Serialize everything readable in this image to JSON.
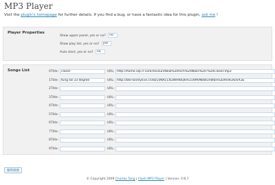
{
  "header": {
    "title": "MP3 Player",
    "intro_prefix": "Visit the ",
    "homepage_link": "plugin's homepage",
    "intro_middle": " for further details. If you find a bug, or have a fantastic idea for this plugin, ",
    "ask_link": "ask me",
    "intro_suffix": " !"
  },
  "player_properties": {
    "label": "Player Properties",
    "options": [
      {
        "label": "Show upper panel, yes or no?",
        "value": "no"
      },
      {
        "label": "Show play list, yes or no?",
        "value": "yes"
      },
      {
        "label": "Auto start, yes or no?",
        "value": "no"
      }
    ]
  },
  "songs_list": {
    "label": "Songs List",
    "title_label": "Title:",
    "url_label": "URL:",
    "songs": [
      {
        "num": "0",
        "title": "closer",
        "url": "http://home.xlp.rr.com/elvisun/New%20Inch%20Nails%20-%20Closer.mp3"
      },
      {
        "num": "1",
        "title": "King k8 33 degree",
        "url": "http://b6l-lonelylive.cn/8z1VNAc1XDWHNiQ6VG5XMVN6W1hWbFRuIzRVdGAoVX3E"
      },
      {
        "num": "2",
        "title": "",
        "url": ""
      },
      {
        "num": "3",
        "title": "",
        "url": ""
      },
      {
        "num": "4",
        "title": "",
        "url": ""
      },
      {
        "num": "5",
        "title": "",
        "url": ""
      },
      {
        "num": "6",
        "title": "",
        "url": ""
      },
      {
        "num": "7",
        "title": "",
        "url": ""
      },
      {
        "num": "8",
        "title": "",
        "url": ""
      },
      {
        "num": "9",
        "title": "",
        "url": ""
      }
    ]
  },
  "save_button": "保存修改",
  "footer": {
    "copyright": "© Copyright 2009 ",
    "author_link": "Charles Tang",
    "sep": " | ",
    "plugin_link": "Flash MP3 Player",
    "version": " | Version: 0.8.7"
  }
}
